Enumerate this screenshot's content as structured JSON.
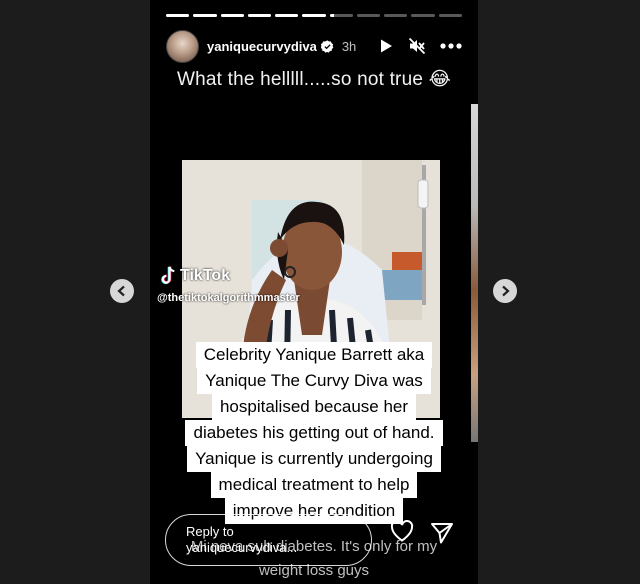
{
  "story": {
    "progress": [
      1,
      1,
      1,
      1,
      1,
      1,
      0.2,
      0,
      0,
      0,
      0
    ],
    "username": "yaniquecurvydiva",
    "time": "3h",
    "caption_top": "What the helllll.....so not true 😂",
    "tiktok_brand": "TikTok",
    "tiktok_handle": "@thetiktokalgorithmmaster",
    "overlay_lines": [
      "Celebrity Yanique Barrett aka",
      "Yanique The Curvy Diva was",
      "hospitalised because her",
      "diabetes his getting out of hand.",
      "Yanique is currently undergoing",
      "medical treatment to help",
      "improve her condition"
    ],
    "caption_bottom_1": "Mi neva suh diabetes. It's only for my",
    "caption_bottom_2": "weight loss guys",
    "reply_line1": "Reply to",
    "reply_line2": "yaniquecurvydiva..."
  },
  "icons": {
    "header": [
      "verified-icon",
      "play-icon",
      "mute-icon",
      "more-icon"
    ],
    "footer": [
      "heart-icon",
      "send-icon"
    ],
    "nav": [
      "chevron-left-icon",
      "chevron-right-icon"
    ]
  },
  "colors": {
    "background": "#1c1c1c",
    "story": "#000000",
    "nav_button": "#d7d7d7",
    "verified": "#ffffff"
  }
}
